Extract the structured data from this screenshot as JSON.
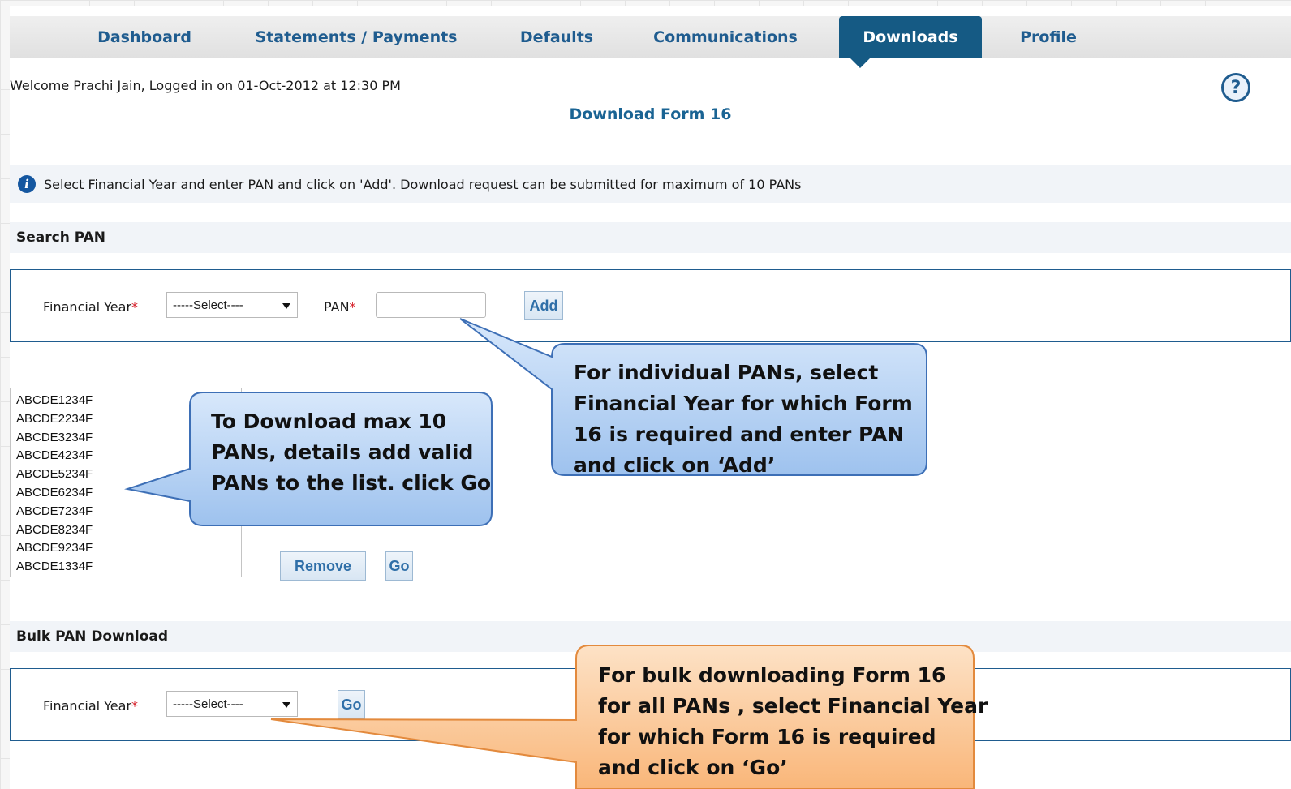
{
  "nav": {
    "tabs": [
      {
        "label": "Dashboard"
      },
      {
        "label": "Statements / Payments"
      },
      {
        "label": "Defaults"
      },
      {
        "label": "Communications"
      },
      {
        "label": "Downloads",
        "active": true
      },
      {
        "label": "Profile"
      }
    ]
  },
  "header": {
    "welcome": "Welcome Prachi Jain, Logged in on 01-Oct-2012 at 12:30 PM",
    "help_icon": "?",
    "title": "Download Form 16"
  },
  "info": {
    "icon": "i",
    "text": "Select Financial Year and enter PAN and click on 'Add'. Download request can be submitted for maximum of 10 PANs"
  },
  "search_pan": {
    "heading": "Search PAN",
    "fy_label": "Financial Year",
    "required_mark": "*",
    "fy_select": "-----Select----",
    "pan_label": "PAN",
    "pan_value": "",
    "add_button": "Add"
  },
  "pan_list": {
    "items": [
      "ABCDE1234F",
      "ABCDE2234F",
      "ABCDE3234F",
      "ABCDE4234F",
      "ABCDE5234F",
      "ABCDE6234F",
      "ABCDE7234F",
      "ABCDE8234F",
      "ABCDE9234F",
      "ABCDE1334F"
    ],
    "remove_button": "Remove",
    "go_button": "Go"
  },
  "bulk": {
    "heading": "Bulk PAN Download",
    "fy_label": "Financial Year",
    "required_mark": "*",
    "fy_select": "-----Select----",
    "go_button": "Go"
  },
  "callouts": {
    "individual": [
      "For individual PANs, select",
      "Financial Year for which Form",
      "16 is required and enter PAN",
      "and click on ‘Add’"
    ],
    "list": [
      "To Download  max 10",
      "PANs, details add valid",
      "PANs to the list. click Go"
    ],
    "bulk": [
      "For bulk downloading Form 16",
      "for all PANs , select Financial Year",
      "for which Form 16 is required",
      "and click on ‘Go’"
    ]
  },
  "colors": {
    "nav_active": "#155a84",
    "nav_text": "#1f5c8f",
    "title": "#1a6494",
    "required": "#d6202a",
    "callout_blue": "#aecdf2",
    "callout_orange": "#fcc595"
  }
}
